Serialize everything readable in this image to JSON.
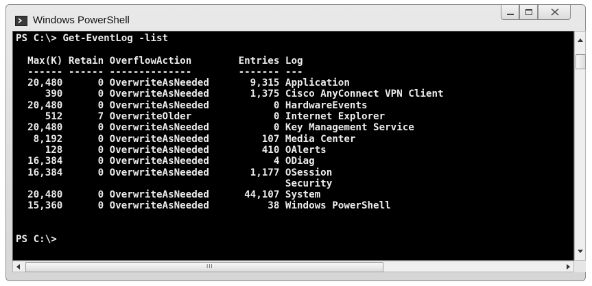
{
  "window": {
    "title": "Windows PowerShell",
    "controls": [
      "minimize",
      "maximize",
      "close"
    ]
  },
  "console": {
    "lines": [
      "PS C:\\> Get-EventLog -list",
      "",
      "  Max(K) Retain OverflowAction        Entries Log",
      "  ------ ------ --------------        ------- ---",
      "  20,480      0 OverwriteAsNeeded       9,315 Application",
      "     390      0 OverwriteAsNeeded       1,375 Cisco AnyConnect VPN Client",
      "  20,480      0 OverwriteAsNeeded           0 HardwareEvents",
      "     512      7 OverwriteOlder              0 Internet Explorer",
      "  20,480      0 OverwriteAsNeeded           0 Key Management Service",
      "   8,192      0 OverwriteAsNeeded         107 Media Center",
      "     128      0 OverwriteAsNeeded         410 OAlerts",
      "  16,384      0 OverwriteAsNeeded           4 ODiag",
      "  16,384      0 OverwriteAsNeeded       1,177 OSession",
      "                                              Security",
      "  20,480      0 OverwriteAsNeeded      44,107 System",
      "  15,360      0 OverwriteAsNeeded          38 Windows PowerShell",
      "",
      "",
      "PS C:\\>"
    ]
  },
  "scrollbars": {
    "vertical": "visible",
    "horizontal": "visible",
    "grip": "III"
  }
}
